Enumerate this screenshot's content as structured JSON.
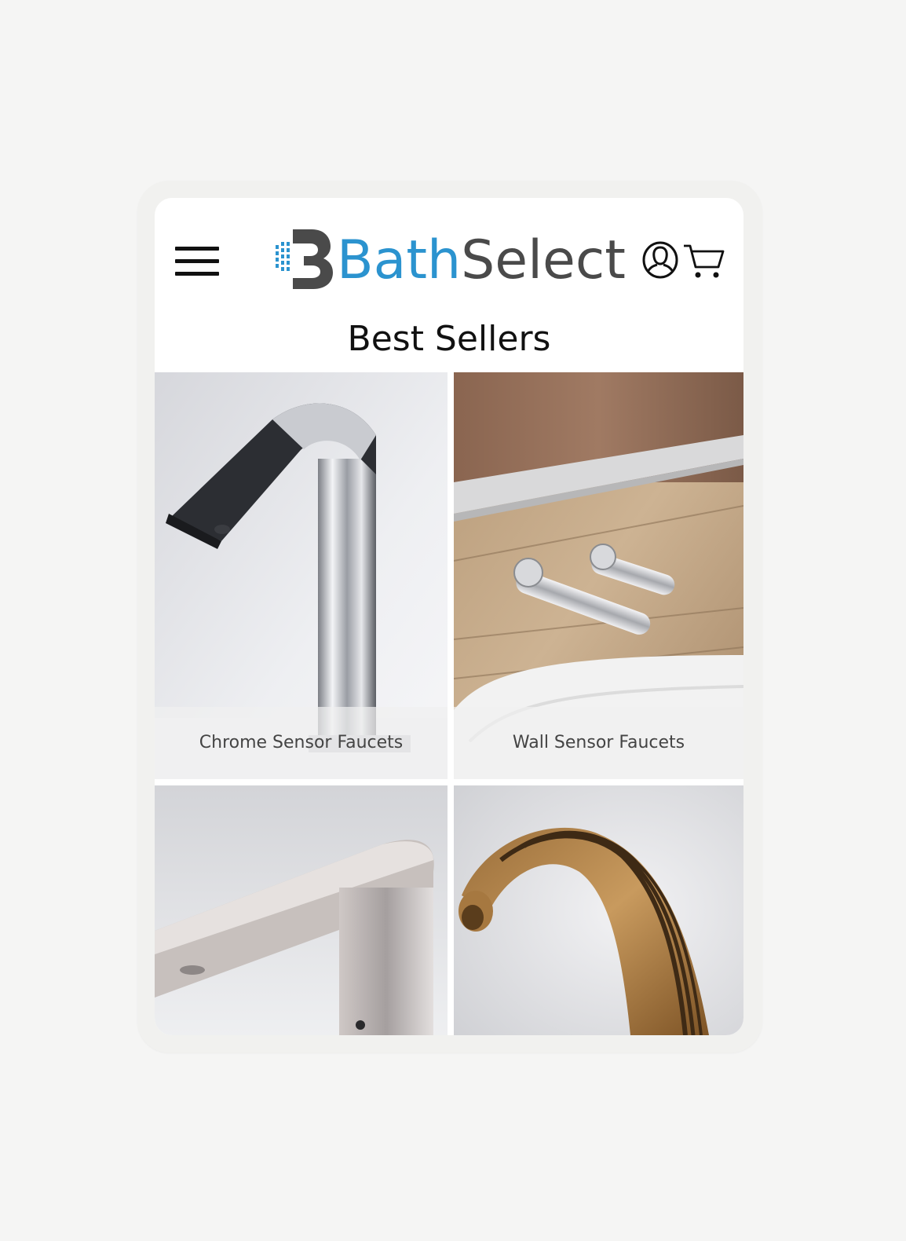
{
  "header": {
    "logo_part1": "Bath",
    "logo_part2": "Select",
    "menu_icon": "hamburger-menu-icon",
    "account_icon": "user-account-icon",
    "cart_icon": "shopping-cart-icon"
  },
  "section": {
    "title": "Best Sellers"
  },
  "products": [
    {
      "label": "Chrome Sensor Faucets"
    },
    {
      "label": "Wall Sensor Faucets"
    },
    {
      "label": ""
    },
    {
      "label": ""
    }
  ],
  "colors": {
    "brand_blue": "#2b93cf",
    "brand_gray": "#4a4a4a",
    "page_bg": "#f5f5f4"
  }
}
